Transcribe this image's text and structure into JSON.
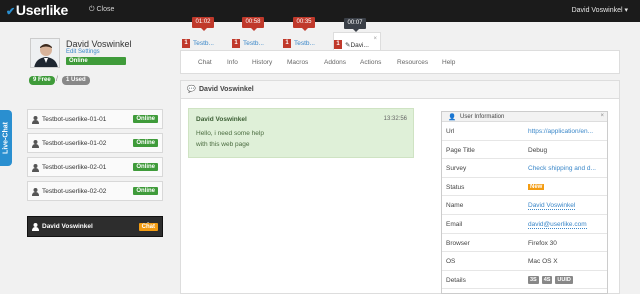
{
  "topbar": {
    "logo": "Userlike",
    "close_label": "Close",
    "user_menu": "David Voswinkel"
  },
  "operator": {
    "name": "David Voswinkel",
    "edit_settings": "Edit Settings",
    "status": "Online",
    "free_slots": "9 Free",
    "separator": "/",
    "used_slots": "1 Used"
  },
  "livechat_tab": "Live-Chat",
  "contacts": [
    {
      "name": "Testbot-userlike-01-01",
      "status": "Online"
    },
    {
      "name": "Testbot-userlike-01-02",
      "status": "Online"
    },
    {
      "name": "Testbot-userlike-02-01",
      "status": "Online"
    },
    {
      "name": "Testbot-userlike-02-02",
      "status": "Online"
    }
  ],
  "active_chat": {
    "name": "David Voswinkel",
    "button": "Chat"
  },
  "chat_tabs": [
    {
      "timer": "01:02",
      "num": "1",
      "label": "Testb..."
    },
    {
      "timer": "00:58",
      "num": "1",
      "label": "Testb..."
    },
    {
      "timer": "00:35",
      "num": "1",
      "label": "Testb..."
    },
    {
      "timer": "00:07",
      "num": "1",
      "label": "Davi...",
      "close": "×"
    }
  ],
  "nav": [
    "Chat",
    "Info",
    "History",
    "Macros",
    "Addons",
    "Actions",
    "Resources",
    "Help"
  ],
  "panel": {
    "title": "David Voswinkel",
    "message": {
      "sender": "David Voswinkel",
      "time": "13:32:56",
      "line1": "Hello, i need some help",
      "line2": "with this web page"
    }
  },
  "user_info": {
    "title": "User Information",
    "close": "×",
    "rows": [
      {
        "key": "Url",
        "value": "https://application/en..."
      },
      {
        "key": "Page Title",
        "value": "Debug"
      },
      {
        "key": "Survey",
        "value": "Check shipping and d..."
      },
      {
        "key": "Status",
        "value": "New"
      },
      {
        "key": "Name",
        "value": "David Voswinkel"
      },
      {
        "key": "Email",
        "value": "david@userlike.com"
      },
      {
        "key": "Browser",
        "value": "Firefox 30"
      },
      {
        "key": "OS",
        "value": "Mac OS X"
      },
      {
        "key": "Details",
        "tags": [
          "3S",
          "4S",
          "UUID"
        ]
      }
    ]
  },
  "colors": {
    "online_green": "#3f9b3a",
    "timer_red": "#c0392b",
    "accent_blue": "#2a8fd0",
    "chat_orange": "#f39c12",
    "message_green": "#dff0d8"
  }
}
